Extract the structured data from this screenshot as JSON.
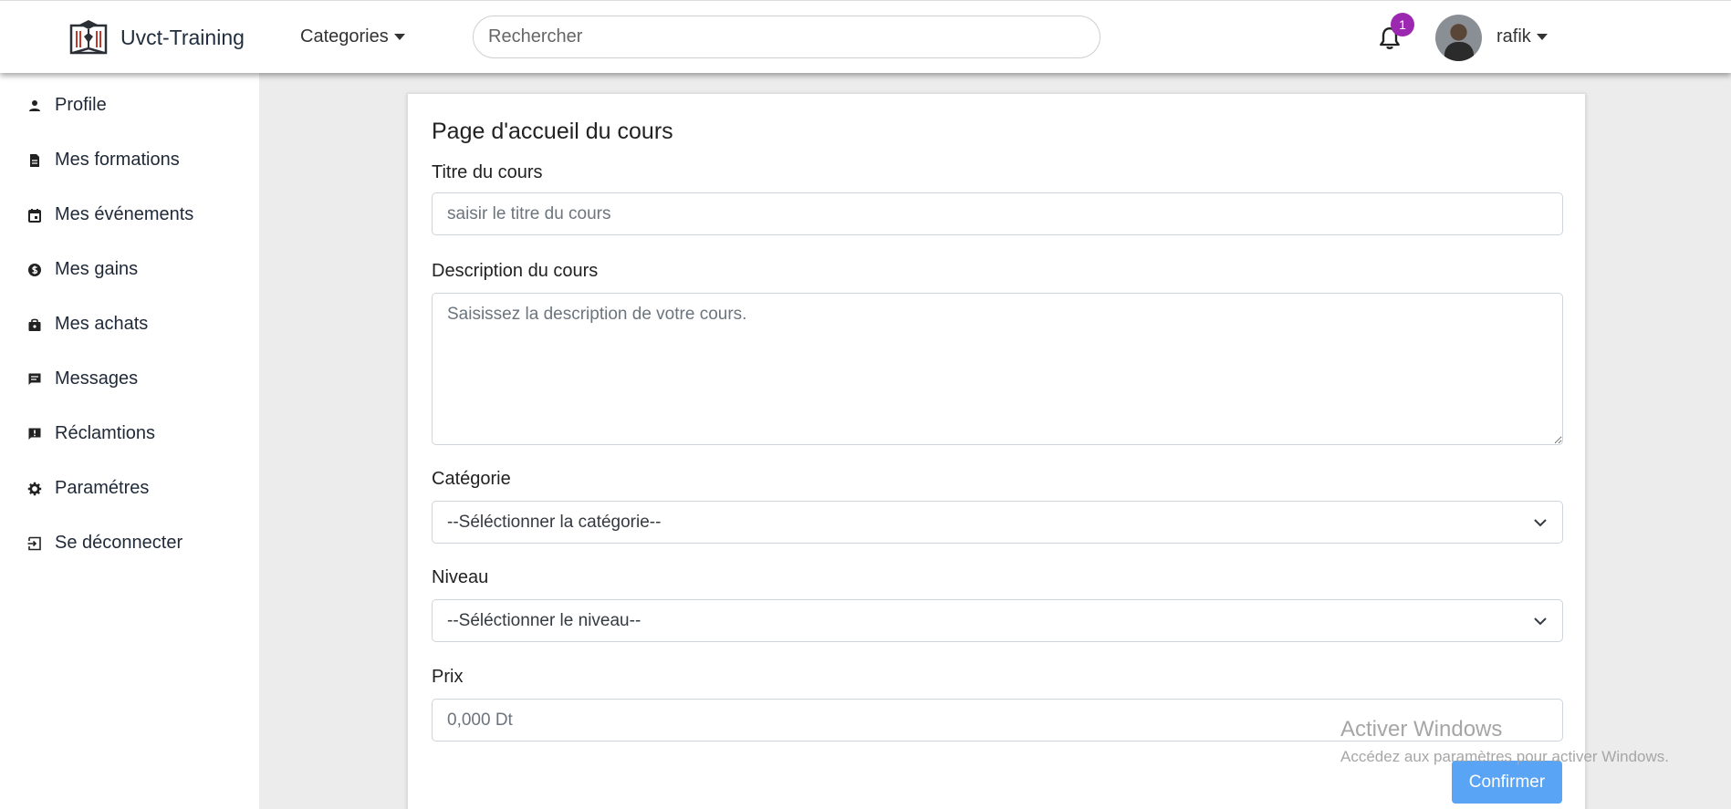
{
  "navbar": {
    "brand": "Uvct-Training",
    "categories_label": "Categories",
    "search_placeholder": "Rechercher",
    "notification_count": "1",
    "username": "rafik"
  },
  "sidebar": {
    "items": [
      {
        "label": "Profile",
        "icon": "person-icon"
      },
      {
        "label": "Mes formations",
        "icon": "document-icon"
      },
      {
        "label": "Mes événements",
        "icon": "calendar-icon"
      },
      {
        "label": "Mes gains",
        "icon": "money-icon"
      },
      {
        "label": "Mes achats",
        "icon": "bag-icon"
      },
      {
        "label": "Messages",
        "icon": "chat-icon"
      },
      {
        "label": "Réclamtions",
        "icon": "report-icon"
      },
      {
        "label": "Paramétres",
        "icon": "gear-icon"
      },
      {
        "label": "Se déconnecter",
        "icon": "logout-icon"
      }
    ]
  },
  "form": {
    "title": "Page d'accueil du cours",
    "course_title_label": "Titre du cours",
    "course_title_placeholder": "saisir le titre du cours",
    "description_label": "Description du cours",
    "description_placeholder": "Saisissez la description de votre cours.",
    "category_label": "Catégorie",
    "category_value": "--Séléctionner la catégorie--",
    "level_label": "Niveau",
    "level_value": "--Séléctionner le niveau--",
    "price_label": "Prix",
    "price_placeholder": "0,000 Dt",
    "confirm_label": "Confirmer"
  },
  "watermark": {
    "title": "Activer Windows",
    "subtitle": "Accédez aux paramètres pour activer Windows."
  },
  "colors": {
    "accent": "#5aa4f5",
    "badge": "#9c27b0",
    "background": "#ececec"
  }
}
